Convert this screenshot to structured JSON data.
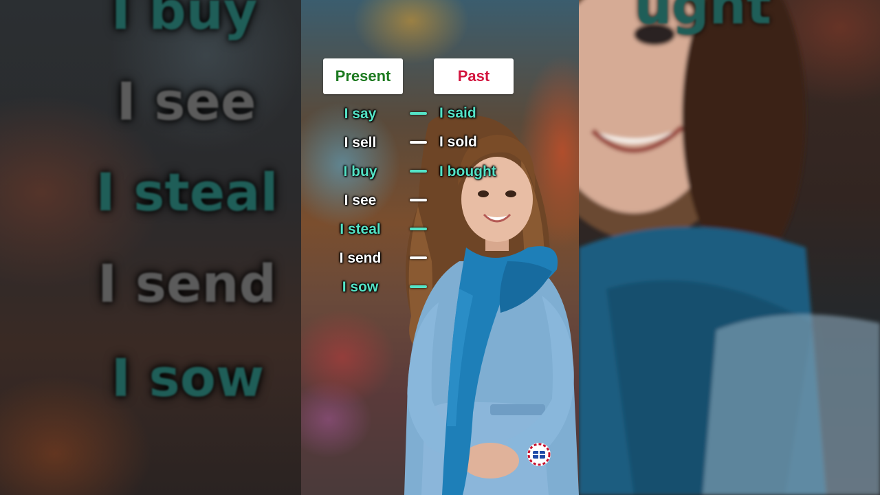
{
  "header": {
    "present_label": "Present",
    "past_label": "Past"
  },
  "rows": [
    {
      "present": "I say",
      "past": "I said",
      "style": "teal"
    },
    {
      "present": "I sell",
      "past": "I sold",
      "style": "white"
    },
    {
      "present": "I buy",
      "past": "I bought",
      "style": "teal"
    },
    {
      "present": "I see",
      "past": "",
      "style": "white"
    },
    {
      "present": "I steal",
      "past": "",
      "style": "teal"
    },
    {
      "present": "I send",
      "past": "",
      "style": "white"
    },
    {
      "present": "I sow",
      "past": "",
      "style": "teal"
    }
  ],
  "side_left_words": [
    "I buy",
    "I see",
    "I steal",
    "I send",
    "I sow"
  ],
  "side_right_word": "ught",
  "colors": {
    "present_header": "#1d7a20",
    "past_header": "#d3153f",
    "teal_text": "#54e3c6",
    "white_text": "#ffffff"
  },
  "logo_icon": "flag-book-logo-icon"
}
